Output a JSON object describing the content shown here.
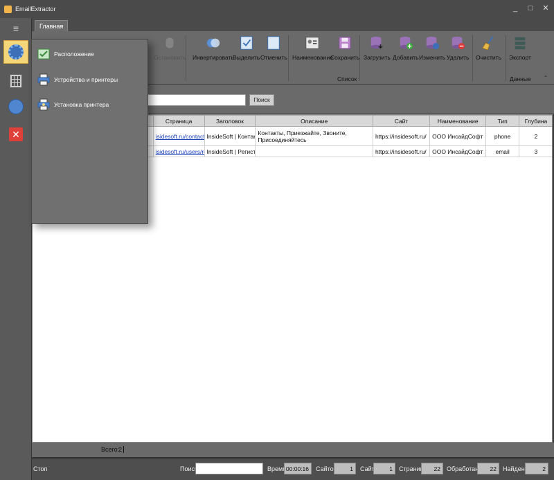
{
  "window": {
    "title": "EmailExtractor",
    "minimize": "_",
    "maximize": "□",
    "close": "✕"
  },
  "sidebar": {
    "menu_icon": "≡"
  },
  "tabs": [
    {
      "label": "Главная"
    }
  ],
  "ribbon": {
    "stop_label": "Остановить",
    "invert_label": "Инвертировать",
    "select_label": "Выделить",
    "cancel_label": "Отменить",
    "name_label": "Наименование",
    "save_label": "Сохранить",
    "load_label": "Загрузить",
    "add_label": "Добавить",
    "edit_label": "Изменить",
    "delete_label": "Удалить",
    "clear_label": "Очистить",
    "export_label": "Экспорт",
    "group_list": "Список",
    "group_data": "Данные"
  },
  "search": {
    "value": "",
    "button_label": "Поиск"
  },
  "dropdown": {
    "items": [
      {
        "label": "Расположение"
      },
      {
        "label": "Устройства и принтеры"
      },
      {
        "label": "Установка принтера"
      }
    ]
  },
  "table": {
    "headers": [
      "Страница",
      "Заголовок",
      "Описание",
      "Сайт",
      "Наименование",
      "Тип",
      "Глубина"
    ],
    "rows": [
      {
        "page": "isidesoft.ru/contacts/",
        "title": "InsideSoft | Контакты",
        "description": "Контакты, Приезжайте, Звоните, Присоединяйтесь",
        "site": "https://insidesoft.ru/",
        "name": "ООО ИнсайдСофт",
        "type": "phone",
        "depth": "2"
      },
      {
        "page": "isidesoft.ru/users/reg...",
        "title": "InsideSoft | Регистрация",
        "description": "",
        "site": "https://insidesoft.ru/",
        "name": "ООО ИнсайдСофт",
        "type": "email",
        "depth": "3"
      }
    ]
  },
  "totals": {
    "label": "Всего:",
    "value": "2"
  },
  "status": {
    "stop_label": "Стоп",
    "search_label": "Поиск",
    "search_value": "",
    "time_label": "Время",
    "time_value": "00:00:16",
    "sites_label": "Сайтов",
    "sites_value": "1",
    "site_label": "Сайт",
    "site_value": "1",
    "pages_label": "Страниц",
    "pages_value": "22",
    "processed_label": "Обработано",
    "processed_value": "22",
    "found_label": "Найдено",
    "found_value": "2"
  }
}
